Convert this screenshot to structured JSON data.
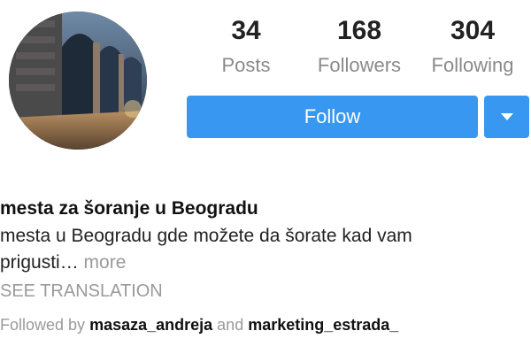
{
  "profile": {
    "avatar_icon": "profile-photo-stone-arcade"
  },
  "stats": [
    {
      "count": "34",
      "label": "Posts"
    },
    {
      "count": "168",
      "label": "Followers"
    },
    {
      "count": "304",
      "label": "Following"
    }
  ],
  "actions": {
    "follow_label": "Follow",
    "dropdown_icon": "caret-down-icon",
    "accent_color": "#3897f0"
  },
  "bio": {
    "name": "mesta za šoranje u Beogradu",
    "text": "mesta u Beogradu gde možete da šorate kad vam prigusti…",
    "more_label": "more",
    "translation_label": "SEE TRANSLATION"
  },
  "followed_by": {
    "prefix": "Followed by",
    "user1": "masaza_andreja",
    "conjunction": "and",
    "user2": "marketing_estrada_"
  }
}
